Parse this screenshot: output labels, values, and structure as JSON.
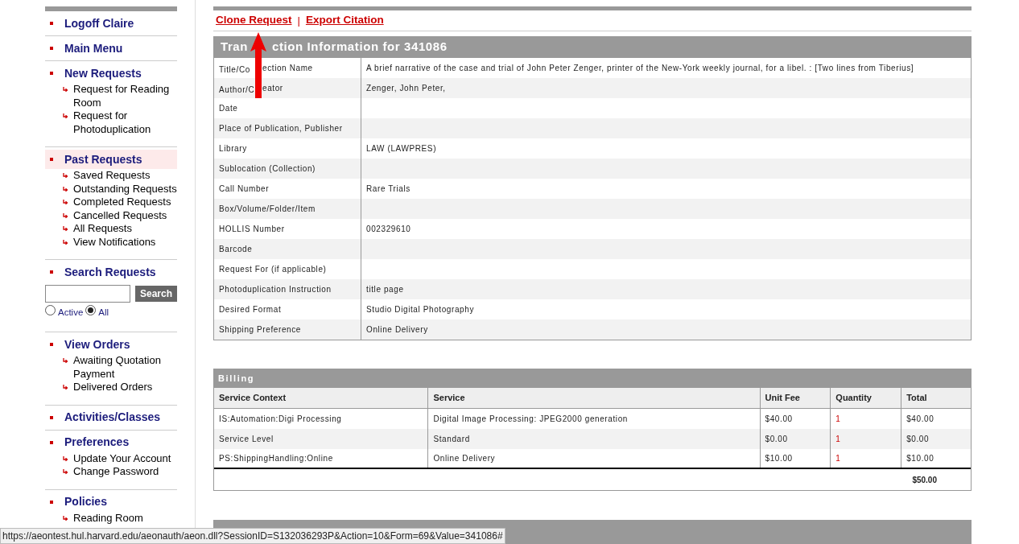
{
  "sidebar": {
    "sections": [
      {
        "kind": "links",
        "label": "Logoff Claire",
        "selected": false
      },
      {
        "kind": "links",
        "label": "Main Menu",
        "selected": false
      },
      {
        "kind": "links",
        "label": "New Requests",
        "selected": false,
        "items": [
          "Request for Reading Room",
          "Request for Photoduplication"
        ]
      },
      {
        "kind": "links",
        "label": "Past Requests",
        "selected": true,
        "items": [
          "Saved Requests",
          "Outstanding Requests",
          "Completed Requests",
          "Cancelled Requests",
          "All Requests",
          "View Notifications"
        ]
      },
      {
        "kind": "search",
        "label": "Search Requests",
        "selected": false,
        "button": "Search",
        "radios": [
          {
            "label": "Active",
            "selected": false
          },
          {
            "label": "All",
            "selected": true
          }
        ]
      },
      {
        "kind": "links",
        "label": "View Orders",
        "selected": false,
        "items": [
          "Awaiting Quotation Payment",
          "Delivered Orders"
        ]
      },
      {
        "kind": "links",
        "label": "Activities/Classes",
        "selected": false
      },
      {
        "kind": "links",
        "label": "Preferences",
        "selected": false,
        "items": [
          "Update Your Account",
          "Change Password"
        ]
      },
      {
        "kind": "links",
        "label": "Policies",
        "selected": false,
        "items": [
          "Reading Room"
        ]
      }
    ]
  },
  "actions": [
    "Clone Request",
    "Export Citation"
  ],
  "action_separator": "|",
  "transaction": {
    "title": [
      "Tran",
      "ction Information for 341086"
    ],
    "rows": [
      {
        "label": [
          "Title/Co",
          "ection Name"
        ],
        "value": "A brief narrative of the case and trial of John Peter Zenger, printer of the New-York weekly journal, for a libel. : [Two lines from Tiberius]"
      },
      {
        "label": [
          "Author/C",
          "eator"
        ],
        "value": "Zenger, John Peter,"
      },
      {
        "label": "Date"
      },
      {
        "label": "Place of Publication, Publisher"
      },
      {
        "label": "Library",
        "value": "LAW (LAWPRES)"
      },
      {
        "label": "Sublocation (Collection)"
      },
      {
        "label": "Call Number",
        "value": "Rare Trials"
      },
      {
        "label": "Box/Volume/Folder/Item"
      },
      {
        "label": "HOLLIS Number",
        "value": "002329610"
      },
      {
        "label": "Barcode"
      },
      {
        "label": "Request For (if applicable)"
      },
      {
        "label": "Photoduplication Instruction",
        "value": "title page"
      },
      {
        "label": "Desired Format",
        "value": "Studio Digital Photography"
      },
      {
        "label": "Shipping Preference",
        "value": "Online Delivery"
      }
    ]
  },
  "billing": {
    "title": "Billing",
    "columns": [
      "Service Context",
      "Service",
      "Unit Fee",
      "Quantity",
      "Total"
    ],
    "rows": [
      [
        "IS:Automation:Digi Processing",
        "Digital Image Processing: JPEG2000 generation",
        "$40.00",
        "1",
        "$40.00"
      ],
      [
        "Service Level",
        "Standard",
        "$0.00",
        "1",
        "$0.00"
      ],
      [
        "PS:ShippingHandling:Online",
        "Online Delivery",
        "$10.00",
        "1",
        "$10.00"
      ]
    ],
    "grand_total": "$50.00"
  },
  "status_bar": "https://aeontest.hul.harvard.edu/aeonauth/aeon.dll?SessionID=S132036293P&Action=10&Form=69&Value=341086#"
}
